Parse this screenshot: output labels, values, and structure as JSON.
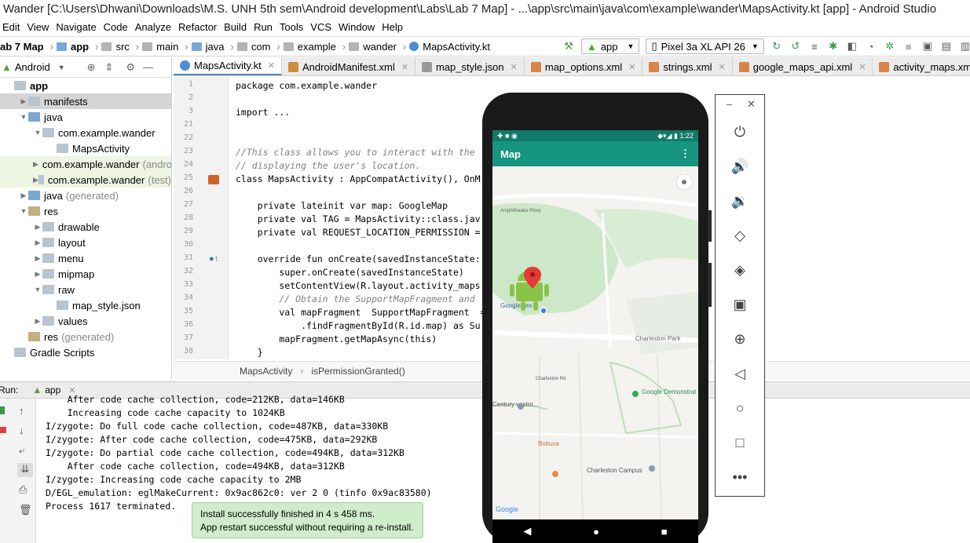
{
  "title": "Wander [C:\\Users\\Dhwani\\Downloads\\M.S. UNH 5th sem\\Android development\\Labs\\Lab 7 Map] - ...\\app\\src\\main\\java\\com\\example\\wander\\MapsActivity.kt [app] - Android Studio",
  "menu": [
    "Edit",
    "View",
    "Navigate",
    "Code",
    "Analyze",
    "Refactor",
    "Build",
    "Run",
    "Tools",
    "VCS",
    "Window",
    "Help"
  ],
  "breadcrumbs": [
    "ab 7 Map",
    "app",
    "src",
    "main",
    "java",
    "com",
    "example",
    "wander",
    "MapsActivity.kt"
  ],
  "run_config": "app",
  "device": "Pixel 3a XL API 26",
  "project": {
    "view_label": "Android",
    "tree": [
      {
        "label": "app",
        "indent": 0,
        "arrow": "",
        "bold": true
      },
      {
        "label": "manifests",
        "indent": 1,
        "arrow": "▶",
        "selected": true
      },
      {
        "label": "java",
        "indent": 1,
        "arrow": "▼"
      },
      {
        "label": "com.example.wander",
        "indent": 2,
        "arrow": "▼"
      },
      {
        "label": "MapsActivity",
        "indent": 3,
        "arrow": ""
      },
      {
        "label": "com.example.wander",
        "suffix": "(androi",
        "indent": 2,
        "arrow": "▶",
        "hl": true
      },
      {
        "label": "com.example.wander",
        "suffix": "(test)",
        "indent": 2,
        "arrow": "▶",
        "hl": true
      },
      {
        "label": "java",
        "suffix": "(generated)",
        "indent": 1,
        "arrow": "▶"
      },
      {
        "label": "res",
        "indent": 1,
        "arrow": "▼"
      },
      {
        "label": "drawable",
        "indent": 2,
        "arrow": "▶"
      },
      {
        "label": "layout",
        "indent": 2,
        "arrow": "▶"
      },
      {
        "label": "menu",
        "indent": 2,
        "arrow": "▶"
      },
      {
        "label": "mipmap",
        "indent": 2,
        "arrow": "▶"
      },
      {
        "label": "raw",
        "indent": 2,
        "arrow": "▼"
      },
      {
        "label": "map_style.json",
        "indent": 3,
        "arrow": ""
      },
      {
        "label": "values",
        "indent": 2,
        "arrow": "▶"
      },
      {
        "label": "res",
        "suffix": "(generated)",
        "indent": 1,
        "arrow": ""
      },
      {
        "label": "Gradle Scripts",
        "indent": 0,
        "arrow": ""
      }
    ]
  },
  "tabs": [
    "MapsActivity.kt",
    "AndroidManifest.xml",
    "map_style.json",
    "map_options.xml",
    "strings.xml",
    "google_maps_api.xml",
    "activity_maps.xml"
  ],
  "code": [
    {
      "n": "1",
      "t": "package com.example.wander"
    },
    {
      "n": "2",
      "t": ""
    },
    {
      "n": "3",
      "t": "import ..."
    },
    {
      "n": "21",
      "t": ""
    },
    {
      "n": "22",
      "t": ""
    },
    {
      "n": "23",
      "t": "//This class allows you to interact with the"
    },
    {
      "n": "24",
      "t": "// displaying the user's location."
    },
    {
      "n": "25",
      "t": "class MapsActivity : AppCompatActivity(), OnM"
    },
    {
      "n": "26",
      "t": ""
    },
    {
      "n": "27",
      "t": "    private lateinit var map: GoogleMap"
    },
    {
      "n": "28",
      "t": "    private val TAG = MapsActivity::class.jav"
    },
    {
      "n": "29",
      "t": "    private val REQUEST_LOCATION_PERMISSION ="
    },
    {
      "n": "30",
      "t": ""
    },
    {
      "n": "31",
      "t": "    override fun onCreate(savedInstanceState:"
    },
    {
      "n": "32",
      "t": "        super.onCreate(savedInstanceState)"
    },
    {
      "n": "33",
      "t": "        setContentView(R.layout.activity_maps"
    },
    {
      "n": "34",
      "t": "        // Obtain the SupportMapFragment and"
    },
    {
      "n": "35",
      "t": "        val mapFragment  SupportMapFragment  ="
    },
    {
      "n": "36",
      "t": "            .findFragmentById(R.id.map) as Su"
    },
    {
      "n": "37",
      "t": "        mapFragment.getMapAsync(this)"
    },
    {
      "n": "38",
      "t": "    }"
    }
  ],
  "editor_breadcrumb": [
    "MapsActivity",
    "isPermissionGranted()"
  ],
  "run": {
    "label": "Run:",
    "config": "app"
  },
  "console": [
    "    After code cache collection, code=212KB, data=146KB",
    "    Increasing code cache capacity to 1024KB",
    "I/zygote: Do full code cache collection, code=487KB, data=330KB",
    "I/zygote: After code cache collection, code=475KB, data=292KB",
    "I/zygote: Do partial code cache collection, code=494KB, data=312KB",
    "    After code cache collection, code=494KB, data=312KB",
    "I/zygote: Increasing code cache capacity to 2MB",
    "D/EGL_emulation: eglMakeCurrent: 0x9ac862c0: ver 2 0 (tinfo 0x9ac83580)",
    "Process 1617 terminated."
  ],
  "toast": {
    "line1": "Install successfully finished in 4 s 458 ms.",
    "line2": "App restart successful without requiring a re-install."
  },
  "phone": {
    "time": "1:22",
    "app_title": "Map",
    "map_labels": {
      "amphitheatre": "Amphitheatre Pkwy",
      "googleplex": "Googleplex",
      "charleston_park": "Charleston\nPark",
      "charleston_rd": "Charleston Rd",
      "century": "Century\nvestor...",
      "demo_garden": "Google Demonstrat\nGarden",
      "boituva": "Boituva",
      "campus": "Charleston Campus",
      "google": "Google"
    }
  },
  "emulator_panel": [
    "power-icon",
    "volume-up-icon",
    "volume-down-icon",
    "rotate-left-icon",
    "rotate-right-icon",
    "camera-icon",
    "zoom-icon",
    "back-icon",
    "home-icon",
    "overview-icon",
    "more-icon"
  ],
  "colors": {
    "accent": "#169580",
    "statusbar": "#127a6b",
    "tab_underline": "#4a88c7",
    "toast_bg": "#cfeccb"
  }
}
